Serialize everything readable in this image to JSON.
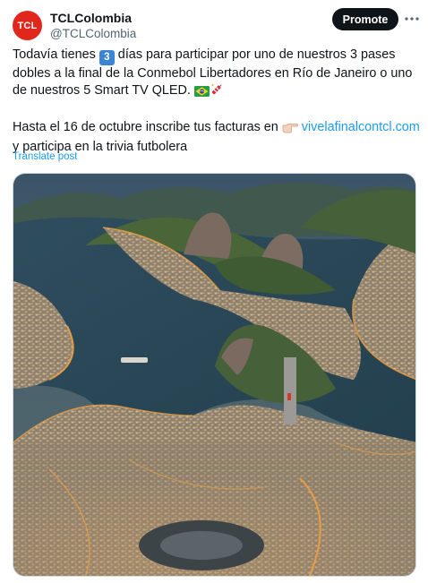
{
  "author": {
    "avatar_text": "TCL",
    "name": "TCLColombia",
    "handle": "@TCLColombia"
  },
  "actions": {
    "promote_label": "Promote",
    "more_icon": "more-horizontal-icon"
  },
  "tweet": {
    "line1_pre": "Todavía tienes ",
    "keycap_number": "3",
    "line1_post": " días para participar por uno de nuestros 3 pases dobles a la final de la Conmebol Libertadores en Río de Janeiro o uno de nuestros 5 Smart TV QLED.",
    "line2_pre": "Hasta el 16 de octubre inscribe tus facturas en ",
    "link": "vivelafinalcontcl.com",
    "line2_post": " y participa en la trivia futbolera",
    "emojis": [
      "brazil-flag",
      "firecracker"
    ],
    "pointing_icon": "pointing-right-hand-icon"
  },
  "translate_label": "Translate post",
  "media": {
    "type": "aerial-city-photo",
    "colors": {
      "water": "#2e4d5e",
      "city": "#8a7a66",
      "lights": "#f0a040",
      "mountain": "#46603a",
      "rock": "#7a6a60",
      "sky": "#3b5468"
    }
  }
}
